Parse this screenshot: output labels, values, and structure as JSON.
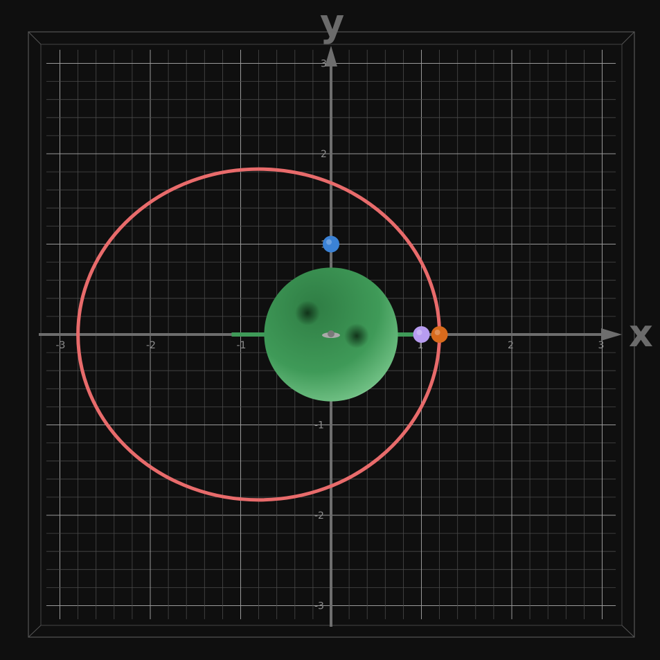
{
  "axes": {
    "x_label": "x",
    "y_label": "y",
    "range": [
      -3,
      3
    ],
    "ticks": [
      -3,
      -2,
      -1,
      1,
      2,
      3
    ],
    "grid": true,
    "minor_divisions": 5
  },
  "colors": {
    "background": "#0f0f0f",
    "axis": "#6e6e6e",
    "grid_major": "#9a9a9a",
    "grid_minor": "#4a4a4a",
    "orbit": "#e86b6b",
    "sphere": "#3f9a58",
    "rod": "#3f9a58"
  },
  "diagram": {
    "ellipse": {
      "center": [
        -0.8,
        0
      ],
      "radius_x": 2.0,
      "radius_y": 1.83
    },
    "central_sphere": {
      "center": [
        0,
        0
      ],
      "radius": 0.74
    },
    "rod": {
      "from": -1.1,
      "to": 1.0
    },
    "points": [
      {
        "name": "blue-point",
        "x": 0.0,
        "y": 1.0,
        "color": "#3b82d6"
      },
      {
        "name": "purple-point",
        "x": 1.0,
        "y": 0.0,
        "color": "#b79cf0"
      },
      {
        "name": "orange-point",
        "x": 1.2,
        "y": 0.0,
        "color": "#d86a1c"
      }
    ]
  }
}
